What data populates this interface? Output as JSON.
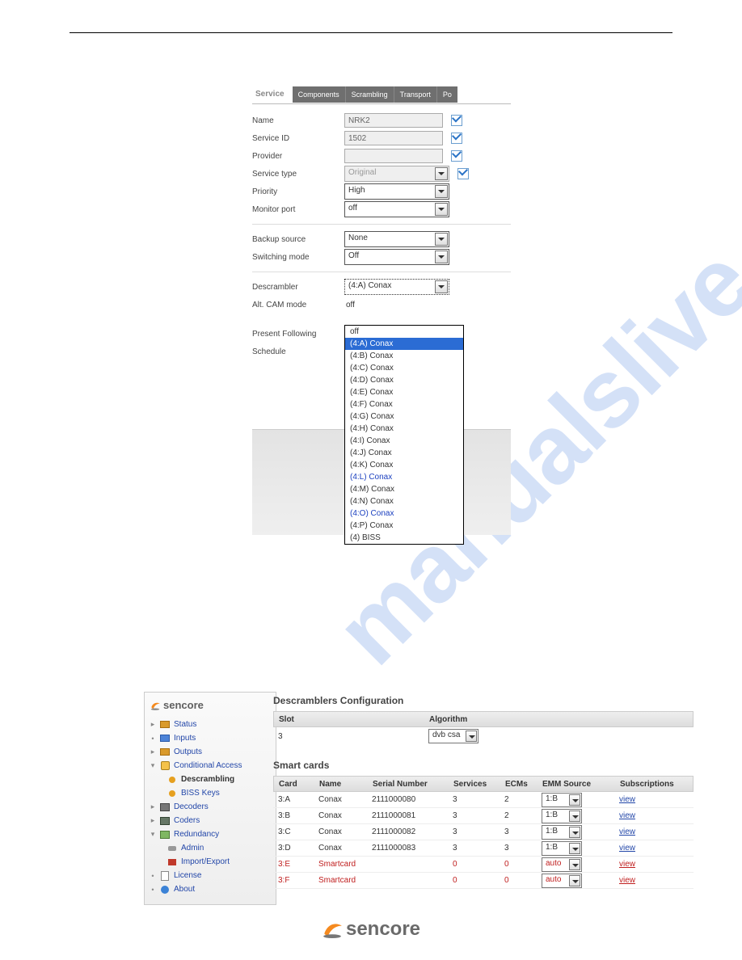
{
  "service_panel": {
    "title": "Service",
    "tabs": [
      "Components",
      "Scrambling",
      "Transport",
      "Po"
    ],
    "rows": [
      {
        "label": "Name",
        "value": "NRK2",
        "kind": "text",
        "readonly": true,
        "check": true
      },
      {
        "label": "Service ID",
        "value": "1502",
        "kind": "text",
        "readonly": true,
        "check": true
      },
      {
        "label": "Provider",
        "value": "",
        "kind": "text",
        "readonly": true,
        "check": true
      },
      {
        "label": "Service type",
        "value": "Original",
        "kind": "select",
        "readonly": true,
        "check": true
      },
      {
        "label": "Priority",
        "value": "High",
        "kind": "select",
        "readonly": false
      },
      {
        "label": "Monitor port",
        "value": "off",
        "kind": "select",
        "readonly": false
      }
    ],
    "group2": [
      {
        "label": "Backup source",
        "value": "None",
        "kind": "select"
      },
      {
        "label": "Switching mode",
        "value": "Off",
        "kind": "select"
      }
    ],
    "group3": [
      {
        "label": "Descrambler",
        "value": "(4:A) Conax",
        "kind": "select",
        "dotted": true
      },
      {
        "label": "Alt. CAM mode",
        "value": "off",
        "kind": "text-static"
      }
    ],
    "group4_labels": [
      "Present Following",
      "Schedule"
    ],
    "dropdown_items": [
      {
        "text": "off",
        "hl": false
      },
      {
        "text": "(4:A) Conax",
        "hl": true
      },
      {
        "text": "(4:B) Conax"
      },
      {
        "text": "(4:C) Conax"
      },
      {
        "text": "(4:D) Conax"
      },
      {
        "text": "(4:E) Conax"
      },
      {
        "text": "(4:F) Conax"
      },
      {
        "text": "(4:G) Conax"
      },
      {
        "text": "(4:H) Conax"
      },
      {
        "text": "(4:I) Conax"
      },
      {
        "text": "(4:J) Conax"
      },
      {
        "text": "(4:K) Conax"
      },
      {
        "text": "(4:L) Conax",
        "blue": true
      },
      {
        "text": "(4:M) Conax"
      },
      {
        "text": "(4:N) Conax"
      },
      {
        "text": "(4:O) Conax",
        "blue": true
      },
      {
        "text": "(4:P) Conax"
      },
      {
        "text": "(4) BISS"
      }
    ]
  },
  "desc_panel": {
    "brand": "sencore",
    "heading": "Descramblers Configuration",
    "nav": [
      {
        "label": "Status",
        "icon": "ico-box",
        "arrow": "▸",
        "link": true
      },
      {
        "label": "Inputs",
        "icon": "ico-boxb",
        "arrow": "•",
        "link": true
      },
      {
        "label": "Outputs",
        "icon": "ico-box",
        "arrow": "▸",
        "link": true
      },
      {
        "label": "Conditional Access",
        "icon": "ico-lock",
        "arrow": "▾",
        "link": true
      },
      {
        "label": "Descrambling",
        "icon": "ico-bullet",
        "sub": true,
        "bold": true
      },
      {
        "label": "BISS Keys",
        "icon": "ico-bullet",
        "sub": true,
        "link": true
      },
      {
        "label": "Decoders",
        "icon": "ico-chip",
        "arrow": "▸",
        "link": true
      },
      {
        "label": "Coders",
        "icon": "ico-stack",
        "arrow": "▸",
        "link": true
      },
      {
        "label": "Redundancy",
        "icon": "ico-folder",
        "arrow": "▾",
        "link": true
      },
      {
        "label": "Admin",
        "icon": "ico-wrench",
        "sub": true,
        "link": true
      },
      {
        "label": "Import/Export",
        "icon": "ico-home",
        "sub": true,
        "link": true
      },
      {
        "label": "License",
        "icon": "ico-doc",
        "arrow": "•",
        "link": true
      },
      {
        "label": "About",
        "icon": "ico-info",
        "arrow": "•",
        "link": true
      }
    ],
    "slot_header": {
      "c1": "Slot",
      "c2": "Algorithm"
    },
    "slot_row": {
      "slot": "3",
      "algorithm": "dvb csa"
    },
    "smartcards_heading": "Smart cards",
    "sc_header": {
      "card": "Card",
      "name": "Name",
      "sn": "Serial Number",
      "svc": "Services",
      "ecm": "ECMs",
      "emm": "EMM Source",
      "sub": "Subscriptions"
    },
    "sc_rows": [
      {
        "card": "3:A",
        "name": "Conax",
        "sn": "2111000080",
        "svc": "3",
        "ecm": "2",
        "emm": "1:B",
        "view": "view"
      },
      {
        "card": "3:B",
        "name": "Conax",
        "sn": "2111000081",
        "svc": "3",
        "ecm": "2",
        "emm": "1:B",
        "view": "view"
      },
      {
        "card": "3:C",
        "name": "Conax",
        "sn": "2111000082",
        "svc": "3",
        "ecm": "3",
        "emm": "1:B",
        "view": "view"
      },
      {
        "card": "3:D",
        "name": "Conax",
        "sn": "2111000083",
        "svc": "3",
        "ecm": "3",
        "emm": "1:B",
        "view": "view"
      },
      {
        "card": "3:E",
        "name": "Smartcard",
        "sn": "",
        "svc": "0",
        "ecm": "0",
        "emm": "auto",
        "view": "view",
        "red": true
      },
      {
        "card": "3:F",
        "name": "Smartcard",
        "sn": "",
        "svc": "0",
        "ecm": "0",
        "emm": "auto",
        "view": "view",
        "red": true
      }
    ]
  },
  "watermark": "manualslive.com",
  "footer_brand": "sencore"
}
